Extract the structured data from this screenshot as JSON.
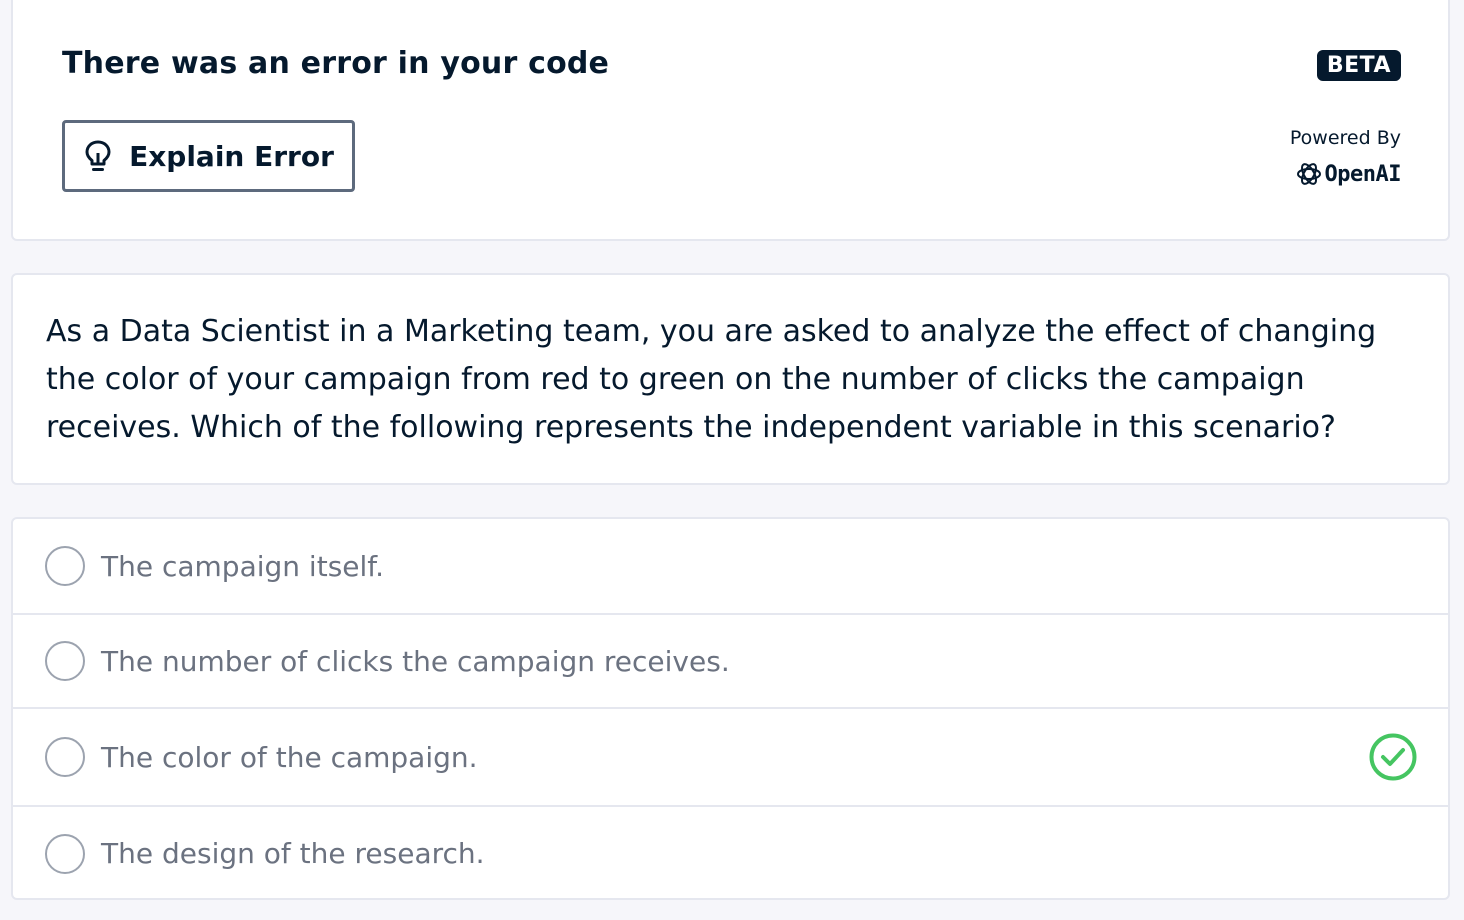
{
  "error_panel": {
    "title": "There was an error in your code",
    "explain_button_label": "Explain Error",
    "beta_badge": "BETA",
    "powered_by": "Powered By",
    "provider_name": "OpenAI"
  },
  "question": {
    "text": "As a Data Scientist in a Marketing team, you are asked to analyze the effect of changing the color of your campaign from red to green on the number of clicks the campaign receives. Which of the following represents the independent variable in this scenario?"
  },
  "options": [
    {
      "label": "The campaign itself.",
      "correct": false
    },
    {
      "label": "The number of clicks the campaign receives.",
      "correct": false
    },
    {
      "label": "The color of the campaign.",
      "correct": true
    },
    {
      "label": "The design of the research.",
      "correct": false
    }
  ],
  "colors": {
    "correct": "#45c561",
    "text_dark": "#05192d",
    "text_muted": "#6b7280"
  },
  "icons": {
    "explain_button": "lightbulb-icon",
    "provider": "openai-logo-icon",
    "correct_answer": "check-circle-icon",
    "option": "radio-circle"
  }
}
